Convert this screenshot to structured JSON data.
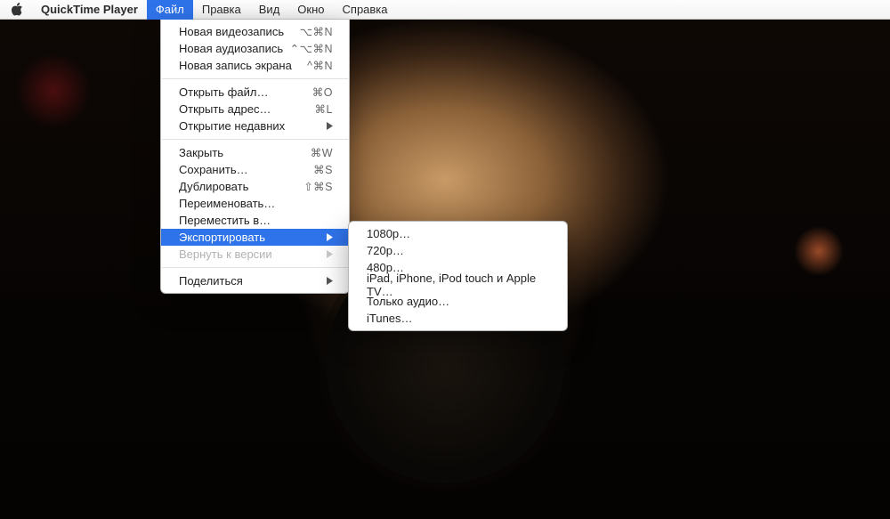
{
  "menubar": {
    "app": "QuickTime Player",
    "items": [
      "Файл",
      "Правка",
      "Вид",
      "Окно",
      "Справка"
    ],
    "active_index": 0
  },
  "file_menu": {
    "groups": [
      [
        {
          "label": "Новая видеозапись",
          "shortcut": "⌥⌘N"
        },
        {
          "label": "Новая аудиозапись",
          "shortcut": "⌃⌥⌘N"
        },
        {
          "label": "Новая запись экрана",
          "shortcut": "^⌘N"
        }
      ],
      [
        {
          "label": "Открыть файл…",
          "shortcut": "⌘O"
        },
        {
          "label": "Открыть адрес…",
          "shortcut": "⌘L"
        },
        {
          "label": "Открытие недавних",
          "submenu": true
        }
      ],
      [
        {
          "label": "Закрыть",
          "shortcut": "⌘W"
        },
        {
          "label": "Сохранить…",
          "shortcut": "⌘S"
        },
        {
          "label": "Дублировать",
          "shortcut": "⇧⌘S"
        },
        {
          "label": "Переименовать…"
        },
        {
          "label": "Переместить в…"
        },
        {
          "label": "Экспортировать",
          "submenu": true,
          "highlight": true
        },
        {
          "label": "Вернуть к версии",
          "submenu": true,
          "disabled": true
        }
      ],
      [
        {
          "label": "Поделиться",
          "submenu": true
        }
      ]
    ]
  },
  "export_submenu": {
    "groups": [
      [
        {
          "label": "1080p…"
        },
        {
          "label": "720p…"
        },
        {
          "label": "480p…"
        },
        {
          "label": "iPad, iPhone, iPod touch и Apple TV…"
        },
        {
          "label": "Только аудио…"
        }
      ],
      [
        {
          "label": "iTunes…"
        }
      ]
    ]
  }
}
